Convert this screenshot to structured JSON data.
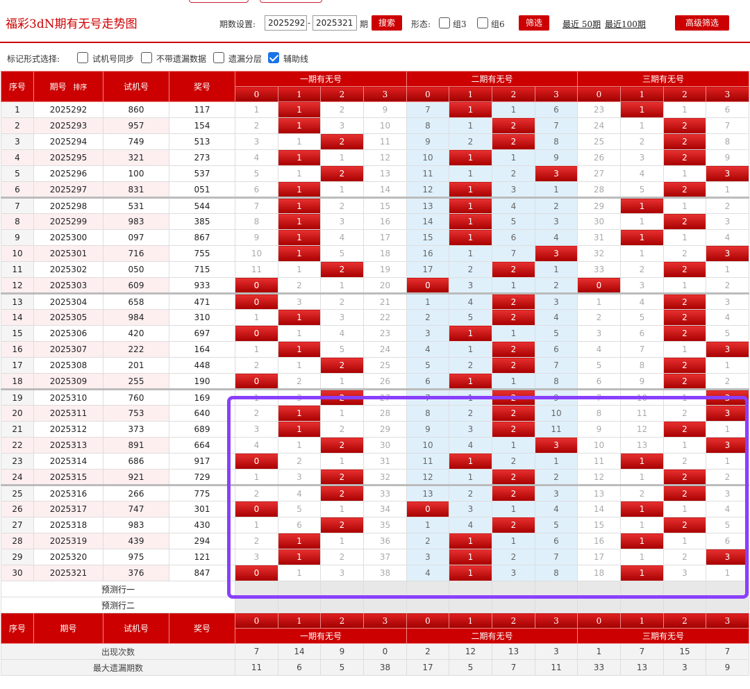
{
  "header": {
    "title": "福彩3dN期有无号走势图",
    "period_label": "期数设置:",
    "period_from": "2025292",
    "period_to": "2025321",
    "period_dash": "-",
    "period_suffix": "期",
    "search_btn": "搜索",
    "shape_label": "形态:",
    "group3": "组3",
    "group6": "组6",
    "filter_btn": "筛选",
    "recent50": "最近 50期",
    "recent100": "最近100期",
    "advanced_btn": "高级筛选"
  },
  "marker_options": {
    "label": "标记形式选择:",
    "opt1": "试机号同步",
    "opt2": "不带遗漏数据",
    "opt3": "遗漏分层",
    "opt4": "辅助线"
  },
  "columns": {
    "seq": "序号",
    "issue": "期号",
    "sort": "排序",
    "test": "试机号",
    "prize": "奖号",
    "group1": "一期有无号",
    "group2": "二期有无号",
    "group3": "三期有无号",
    "digits": [
      "0",
      "1",
      "2",
      "3"
    ]
  },
  "rows": [
    {
      "n": "1",
      "issue": "2025292",
      "test": "860",
      "prize": "117",
      "g1": [
        "1",
        "1",
        "2",
        "9"
      ],
      "h1": 1,
      "g2": [
        "7",
        "1",
        "1",
        "6"
      ],
      "h2": 1,
      "g3": [
        "23",
        "1",
        "1",
        "6"
      ],
      "h3": 1
    },
    {
      "n": "2",
      "issue": "2025293",
      "test": "957",
      "prize": "154",
      "g1": [
        "2",
        "1",
        "3",
        "10"
      ],
      "h1": 1,
      "g2": [
        "8",
        "1",
        "2",
        "7"
      ],
      "h2": 2,
      "g3": [
        "24",
        "1",
        "2",
        "7"
      ],
      "h3": 2
    },
    {
      "n": "3",
      "issue": "2025294",
      "test": "749",
      "prize": "513",
      "g1": [
        "3",
        "1",
        "2",
        "11"
      ],
      "h1": 2,
      "g2": [
        "9",
        "2",
        "2",
        "8"
      ],
      "h2": 2,
      "g3": [
        "25",
        "2",
        "2",
        "8"
      ],
      "h3": 2
    },
    {
      "n": "4",
      "issue": "2025295",
      "test": "321",
      "prize": "273",
      "g1": [
        "4",
        "1",
        "1",
        "12"
      ],
      "h1": 1,
      "g2": [
        "10",
        "1",
        "1",
        "9"
      ],
      "h2": 1,
      "g3": [
        "26",
        "3",
        "2",
        "9"
      ],
      "h3": 2
    },
    {
      "n": "5",
      "issue": "2025296",
      "test": "100",
      "prize": "537",
      "g1": [
        "5",
        "1",
        "2",
        "13"
      ],
      "h1": 2,
      "g2": [
        "11",
        "1",
        "2",
        "3"
      ],
      "h2": 3,
      "g3": [
        "27",
        "4",
        "1",
        "3"
      ],
      "h3": 3
    },
    {
      "n": "6",
      "issue": "2025297",
      "test": "831",
      "prize": "051",
      "g1": [
        "6",
        "1",
        "1",
        "14"
      ],
      "h1": 1,
      "g2": [
        "12",
        "1",
        "3",
        "1"
      ],
      "h2": 1,
      "g3": [
        "28",
        "5",
        "2",
        "1"
      ],
      "h3": 2
    },
    {
      "n": "7",
      "issue": "2025298",
      "test": "531",
      "prize": "544",
      "g1": [
        "7",
        "1",
        "2",
        "15"
      ],
      "h1": 1,
      "g2": [
        "13",
        "1",
        "4",
        "2"
      ],
      "h2": 1,
      "g3": [
        "29",
        "1",
        "1",
        "2"
      ],
      "h3": 1
    },
    {
      "n": "8",
      "issue": "2025299",
      "test": "983",
      "prize": "385",
      "g1": [
        "8",
        "1",
        "3",
        "16"
      ],
      "h1": 1,
      "g2": [
        "14",
        "1",
        "5",
        "3"
      ],
      "h2": 1,
      "g3": [
        "30",
        "1",
        "2",
        "3"
      ],
      "h3": 2
    },
    {
      "n": "9",
      "issue": "2025300",
      "test": "097",
      "prize": "867",
      "g1": [
        "9",
        "1",
        "4",
        "17"
      ],
      "h1": 1,
      "g2": [
        "15",
        "1",
        "6",
        "4"
      ],
      "h2": 1,
      "g3": [
        "31",
        "1",
        "1",
        "4"
      ],
      "h3": 1
    },
    {
      "n": "10",
      "issue": "2025301",
      "test": "716",
      "prize": "755",
      "g1": [
        "10",
        "1",
        "5",
        "18"
      ],
      "h1": 1,
      "g2": [
        "16",
        "1",
        "7",
        "3"
      ],
      "h2": 3,
      "g3": [
        "32",
        "1",
        "2",
        "3"
      ],
      "h3": 3
    },
    {
      "n": "11",
      "issue": "2025302",
      "test": "050",
      "prize": "715",
      "g1": [
        "11",
        "1",
        "2",
        "19"
      ],
      "h1": 2,
      "g2": [
        "17",
        "2",
        "2",
        "1"
      ],
      "h2": 2,
      "g3": [
        "33",
        "2",
        "2",
        "1"
      ],
      "h3": 2
    },
    {
      "n": "12",
      "issue": "2025303",
      "test": "609",
      "prize": "933",
      "g1": [
        "0",
        "2",
        "1",
        "20"
      ],
      "h1": 0,
      "g2": [
        "0",
        "3",
        "1",
        "2"
      ],
      "h2": 0,
      "g3": [
        "0",
        "3",
        "1",
        "2"
      ],
      "h3": 0
    },
    {
      "n": "13",
      "issue": "2025304",
      "test": "658",
      "prize": "471",
      "g1": [
        "0",
        "3",
        "2",
        "21"
      ],
      "h1": 0,
      "g2": [
        "1",
        "4",
        "2",
        "3"
      ],
      "h2": 2,
      "g3": [
        "1",
        "4",
        "2",
        "3"
      ],
      "h3": 2
    },
    {
      "n": "14",
      "issue": "2025305",
      "test": "984",
      "prize": "310",
      "g1": [
        "1",
        "1",
        "3",
        "22"
      ],
      "h1": 1,
      "g2": [
        "2",
        "5",
        "2",
        "4"
      ],
      "h2": 2,
      "g3": [
        "2",
        "5",
        "2",
        "4"
      ],
      "h3": 2
    },
    {
      "n": "15",
      "issue": "2025306",
      "test": "420",
      "prize": "697",
      "g1": [
        "0",
        "1",
        "4",
        "23"
      ],
      "h1": 0,
      "g2": [
        "3",
        "1",
        "1",
        "5"
      ],
      "h2": 1,
      "g3": [
        "3",
        "6",
        "2",
        "5"
      ],
      "h3": 2
    },
    {
      "n": "16",
      "issue": "2025307",
      "test": "222",
      "prize": "164",
      "g1": [
        "1",
        "1",
        "5",
        "24"
      ],
      "h1": 1,
      "g2": [
        "4",
        "1",
        "2",
        "6"
      ],
      "h2": 2,
      "g3": [
        "4",
        "7",
        "1",
        "3"
      ],
      "h3": 3
    },
    {
      "n": "17",
      "issue": "2025308",
      "test": "201",
      "prize": "448",
      "g1": [
        "2",
        "1",
        "2",
        "25"
      ],
      "h1": 2,
      "g2": [
        "5",
        "2",
        "2",
        "7"
      ],
      "h2": 2,
      "g3": [
        "5",
        "8",
        "2",
        "1"
      ],
      "h3": 2
    },
    {
      "n": "18",
      "issue": "2025309",
      "test": "255",
      "prize": "190",
      "g1": [
        "0",
        "2",
        "1",
        "26"
      ],
      "h1": 0,
      "g2": [
        "6",
        "1",
        "1",
        "8"
      ],
      "h2": 1,
      "g3": [
        "6",
        "9",
        "2",
        "2"
      ],
      "h3": 2
    },
    {
      "n": "19",
      "issue": "2025310",
      "test": "760",
      "prize": "169",
      "g1": [
        "1",
        "3",
        "2",
        "27"
      ],
      "h1": 2,
      "g2": [
        "7",
        "1",
        "2",
        "9"
      ],
      "h2": 2,
      "g3": [
        "7",
        "10",
        "1",
        "3"
      ],
      "h3": 3
    },
    {
      "n": "20",
      "issue": "2025311",
      "test": "753",
      "prize": "640",
      "g1": [
        "2",
        "1",
        "1",
        "28"
      ],
      "h1": 1,
      "g2": [
        "8",
        "2",
        "2",
        "10"
      ],
      "h2": 2,
      "g3": [
        "8",
        "11",
        "2",
        "3"
      ],
      "h3": 3
    },
    {
      "n": "21",
      "issue": "2025312",
      "test": "373",
      "prize": "689",
      "g1": [
        "3",
        "1",
        "2",
        "29"
      ],
      "h1": 1,
      "g2": [
        "9",
        "3",
        "2",
        "11"
      ],
      "h2": 2,
      "g3": [
        "9",
        "12",
        "2",
        "1"
      ],
      "h3": 2
    },
    {
      "n": "22",
      "issue": "2025313",
      "test": "891",
      "prize": "664",
      "g1": [
        "4",
        "1",
        "2",
        "30"
      ],
      "h1": 2,
      "g2": [
        "10",
        "4",
        "1",
        "3"
      ],
      "h2": 3,
      "g3": [
        "10",
        "13",
        "1",
        "3"
      ],
      "h3": 3
    },
    {
      "n": "23",
      "issue": "2025314",
      "test": "686",
      "prize": "917",
      "g1": [
        "0",
        "2",
        "1",
        "31"
      ],
      "h1": 0,
      "g2": [
        "11",
        "1",
        "2",
        "1"
      ],
      "h2": 1,
      "g3": [
        "11",
        "1",
        "2",
        "1"
      ],
      "h3": 1
    },
    {
      "n": "24",
      "issue": "2025315",
      "test": "921",
      "prize": "729",
      "g1": [
        "1",
        "3",
        "2",
        "32"
      ],
      "h1": 2,
      "g2": [
        "12",
        "1",
        "2",
        "2"
      ],
      "h2": 2,
      "g3": [
        "12",
        "1",
        "2",
        "2"
      ],
      "h3": 2
    },
    {
      "n": "25",
      "issue": "2025316",
      "test": "266",
      "prize": "775",
      "g1": [
        "2",
        "4",
        "2",
        "33"
      ],
      "h1": 2,
      "g2": [
        "13",
        "2",
        "2",
        "3"
      ],
      "h2": 2,
      "g3": [
        "13",
        "2",
        "2",
        "3"
      ],
      "h3": 2
    },
    {
      "n": "26",
      "issue": "2025317",
      "test": "747",
      "prize": "301",
      "g1": [
        "0",
        "5",
        "1",
        "34"
      ],
      "h1": 0,
      "g2": [
        "0",
        "3",
        "1",
        "4"
      ],
      "h2": 0,
      "g3": [
        "14",
        "1",
        "1",
        "4"
      ],
      "h3": 1
    },
    {
      "n": "27",
      "issue": "2025318",
      "test": "983",
      "prize": "430",
      "g1": [
        "1",
        "6",
        "2",
        "35"
      ],
      "h1": 2,
      "g2": [
        "1",
        "4",
        "2",
        "5"
      ],
      "h2": 2,
      "g3": [
        "15",
        "1",
        "2",
        "5"
      ],
      "h3": 2
    },
    {
      "n": "28",
      "issue": "2025319",
      "test": "439",
      "prize": "294",
      "g1": [
        "2",
        "1",
        "1",
        "36"
      ],
      "h1": 1,
      "g2": [
        "2",
        "1",
        "1",
        "6"
      ],
      "h2": 1,
      "g3": [
        "16",
        "1",
        "1",
        "6"
      ],
      "h3": 1
    },
    {
      "n": "29",
      "issue": "2025320",
      "test": "975",
      "prize": "121",
      "g1": [
        "3",
        "1",
        "2",
        "37"
      ],
      "h1": 1,
      "g2": [
        "3",
        "1",
        "2",
        "7"
      ],
      "h2": 1,
      "g3": [
        "17",
        "1",
        "2",
        "3"
      ],
      "h3": 3
    },
    {
      "n": "30",
      "issue": "2025321",
      "test": "376",
      "prize": "847",
      "g1": [
        "0",
        "1",
        "3",
        "38"
      ],
      "h1": 0,
      "g2": [
        "4",
        "1",
        "3",
        "8"
      ],
      "h2": 1,
      "g3": [
        "18",
        "1",
        "3",
        "1"
      ],
      "h3": 1
    }
  ],
  "prediction": {
    "row1": "预测行一",
    "row2": "预测行二"
  },
  "stats": {
    "appear_label": "出现次数",
    "appear": [
      "7",
      "14",
      "9",
      "0",
      "2",
      "12",
      "13",
      "3",
      "1",
      "7",
      "15",
      "7"
    ],
    "maxmiss_label": "最大遗漏期数",
    "maxmiss": [
      "11",
      "6",
      "5",
      "38",
      "17",
      "5",
      "7",
      "11",
      "33",
      "13",
      "3",
      "9"
    ]
  },
  "colors": {
    "accent": "#cc0000",
    "highlight_box": "#8a3ffc",
    "mid_group_bg": "#dff0fb"
  }
}
